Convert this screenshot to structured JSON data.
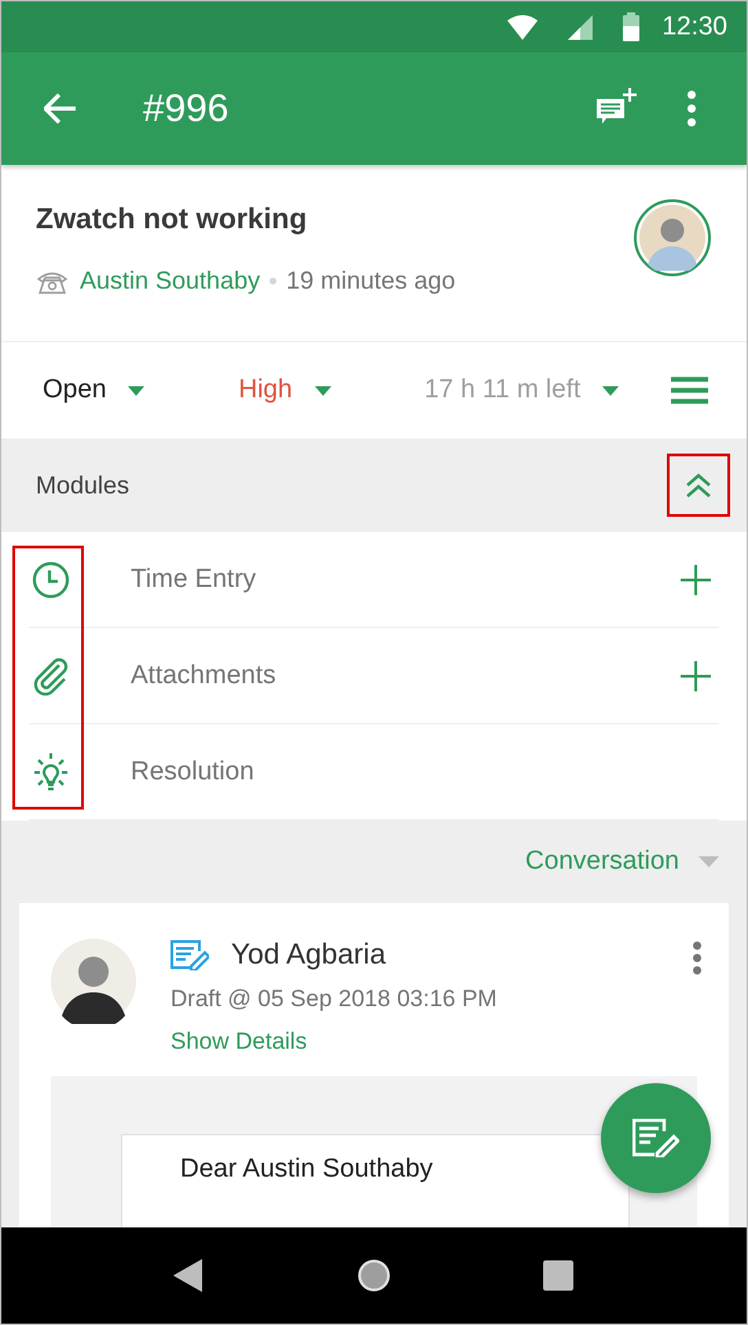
{
  "status_bar": {
    "time": "12:30"
  },
  "app_bar": {
    "title": "#996"
  },
  "ticket": {
    "subject": "Zwatch not working",
    "requester": "Austin Southaby",
    "age": "19 minutes ago"
  },
  "fields": [
    {
      "kind": "status",
      "label": "Open",
      "color": "#212121"
    },
    {
      "kind": "priority",
      "label": "High",
      "color": "#e0533f"
    },
    {
      "kind": "due",
      "label": "17 h 11 m left",
      "color": "#9e9e9e"
    }
  ],
  "modules": {
    "title": "Modules",
    "expanded": true,
    "toggle_highlighted": true,
    "icons_highlighted": true,
    "items": [
      {
        "kind": "time",
        "label": "Time Entry",
        "addable": true
      },
      {
        "kind": "attachment",
        "label": "Attachments",
        "addable": true
      },
      {
        "kind": "resolution",
        "label": "Resolution",
        "addable": false
      }
    ]
  },
  "conversation": {
    "filter": "Conversation",
    "message": {
      "author": "Yod Agbaria",
      "meta": "Draft @ 05 Sep 2018 03:16 PM",
      "link": "Show Details",
      "body": "Dear Austin Southaby"
    }
  }
}
